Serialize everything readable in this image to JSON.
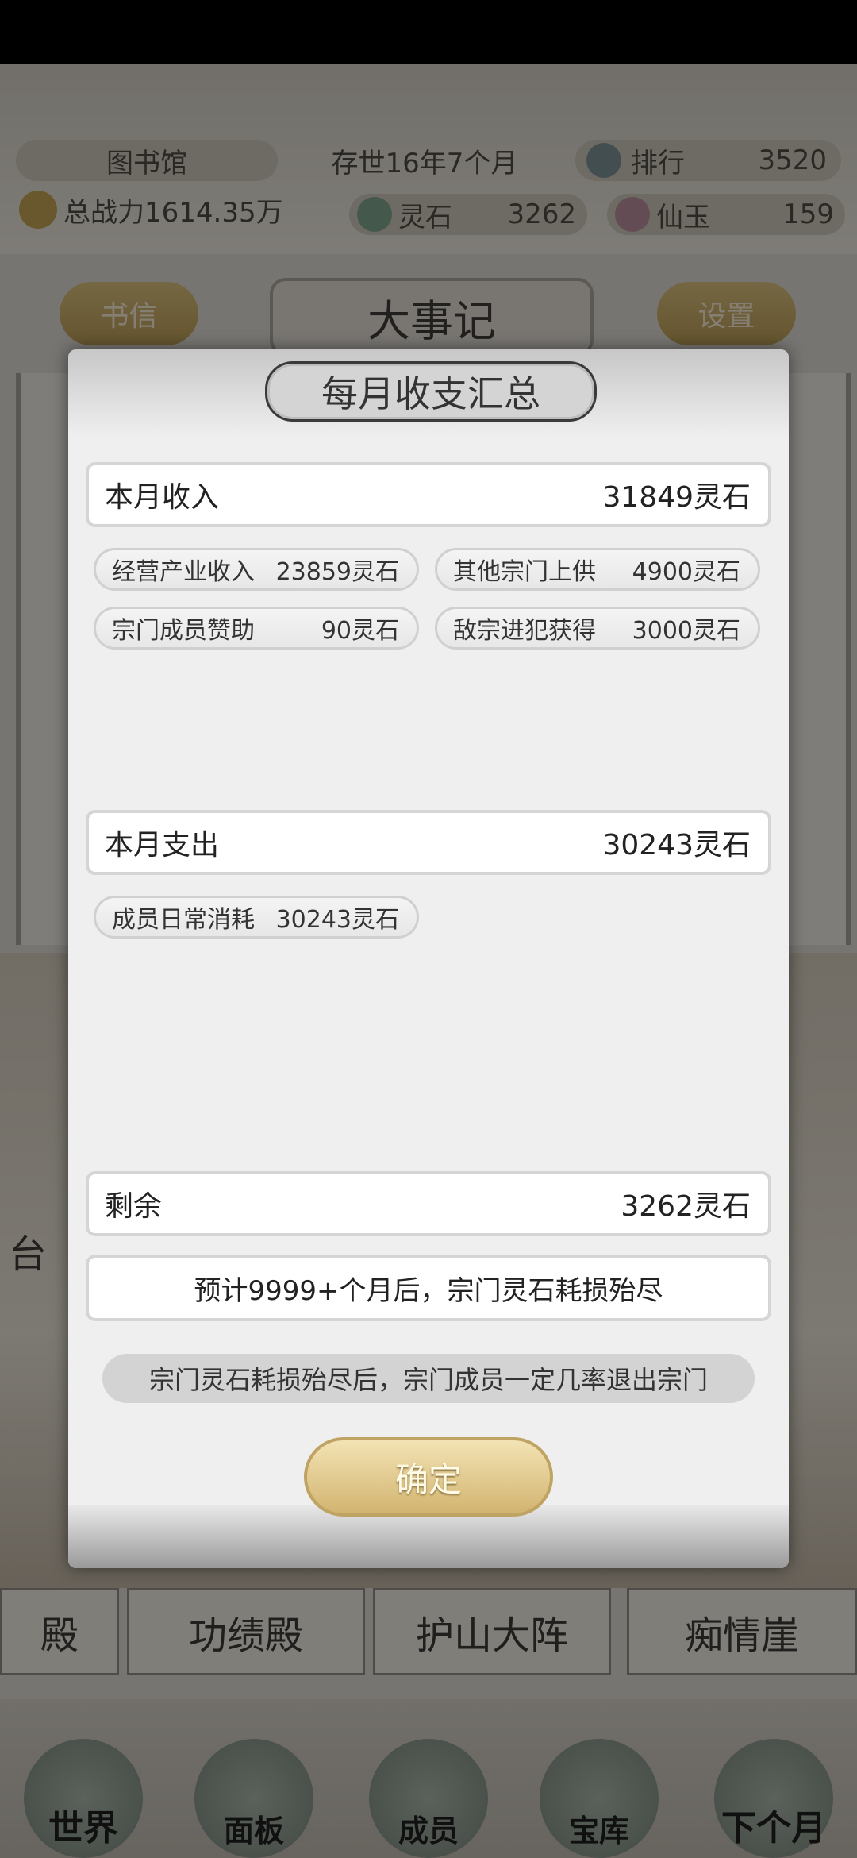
{
  "topbar": {
    "location": "图书馆",
    "age": "存世16年7个月",
    "ranking_label": "排行",
    "ranking_value": "3520",
    "power": "总战力1614.35万",
    "spirit_stone_label": "灵石",
    "spirit_stone_value": "3262",
    "jade_label": "仙玉",
    "jade_value": "159"
  },
  "hall": {
    "letters_button": "书信",
    "title": "大事记",
    "settings_button": "设置"
  },
  "buildings": [
    "台",
    "殿",
    "功绩殿",
    "护山大阵",
    "痴情崖"
  ],
  "bottom_nav": [
    {
      "label": "世界"
    },
    {
      "label": "面板"
    },
    {
      "label": "成员"
    },
    {
      "label": "宝库"
    },
    {
      "label": "下个月"
    }
  ],
  "dialog": {
    "title": "每月收支汇总",
    "income": {
      "label": "本月收入",
      "total": "31849灵石",
      "items": [
        {
          "name": "经营产业收入",
          "value": "23859灵石"
        },
        {
          "name": "其他宗门上供",
          "value": "4900灵石"
        },
        {
          "name": "宗门成员赞助",
          "value": "90灵石"
        },
        {
          "name": "敌宗进犯获得",
          "value": "3000灵石"
        }
      ]
    },
    "expense": {
      "label": "本月支出",
      "total": "30243灵石",
      "items": [
        {
          "name": "成员日常消耗",
          "value": "30243灵石"
        }
      ]
    },
    "balance": {
      "label": "剩余",
      "value": "3262灵石"
    },
    "forecast": "预计9999+个月后，宗门灵石耗损殆尽",
    "warning": "宗门灵石耗损殆尽后，宗门成员一定几率退出宗门",
    "confirm_button": "确定"
  }
}
